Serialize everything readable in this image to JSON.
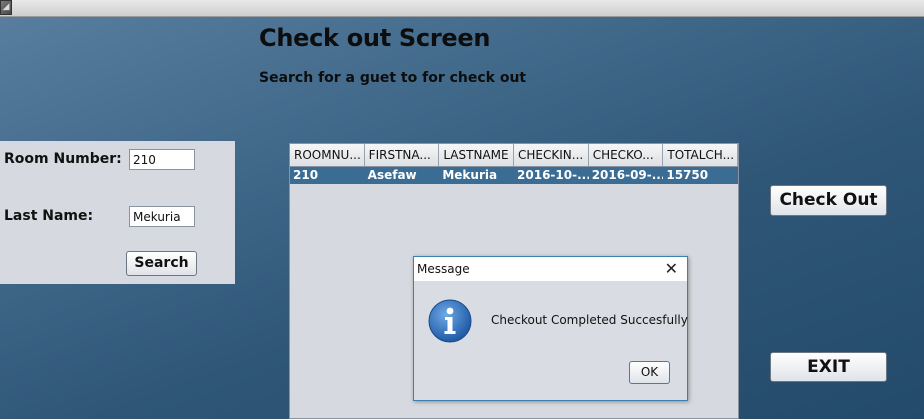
{
  "window": {
    "corner_icon": "resize-corner-icon"
  },
  "header": {
    "title": "Check out Screen",
    "subtitle": "Search for a guet to for check out"
  },
  "search_form": {
    "room_label": "Room Number:",
    "room_value": "210",
    "lastname_label": "Last Name:",
    "lastname_value": "Mekuria",
    "search_label": "Search"
  },
  "table": {
    "columns": [
      "ROOMNU...",
      "FIRSTNA...",
      "LASTNAME",
      "CHECKIN...",
      "CHECKO...",
      "TOTALCH..."
    ],
    "rows": [
      [
        "210",
        "Asefaw",
        "Mekuria",
        "2016-10-...",
        "2016-09-...",
        "15750"
      ]
    ]
  },
  "actions": {
    "checkout_label": "Check Out",
    "exit_label": "EXIT"
  },
  "dialog": {
    "title": "Message",
    "close_glyph": "✕",
    "icon": "info-icon",
    "message": "Checkout Completed Succesfully",
    "ok_label": "OK"
  },
  "colors": {
    "background": "#3f6788",
    "selected_row": "#3b6c93",
    "dialog_border": "#3c7fb1",
    "info_icon": "#2f6db8"
  }
}
